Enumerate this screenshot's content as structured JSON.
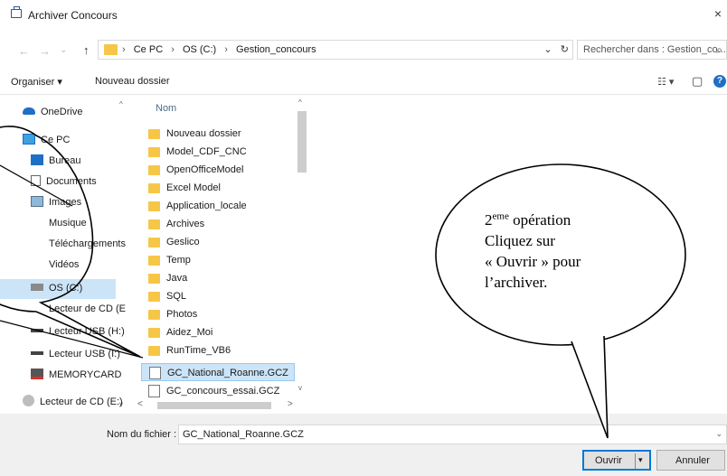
{
  "window": {
    "title": "Archiver Concours",
    "close_glyph": "×"
  },
  "nav_buttons": {
    "back": "←",
    "forward": "→",
    "recent": "⌄",
    "up": "↑"
  },
  "address": {
    "crumbs": [
      "Ce PC",
      "OS (C:)",
      "Gestion_concours"
    ],
    "separator": "›",
    "dropdown_glyph": "⌄",
    "refresh_glyph": "↻"
  },
  "search": {
    "placeholder": "Rechercher dans : Gestion_co...",
    "icon": "search-icon",
    "glyph": "⌕"
  },
  "toolbar": {
    "organise_label": "Organiser ▾",
    "new_folder_label": "Nouveau dossier",
    "view_glyph": "☷ ▾",
    "preview_glyph": "▢",
    "help_glyph": "?"
  },
  "navigation": {
    "items": [
      {
        "label": "OneDrive",
        "icon": "cloud-icon"
      },
      {
        "label": "Ce PC",
        "icon": "computer-icon"
      },
      {
        "label": "Bureau",
        "icon": "desktop-icon"
      },
      {
        "label": "Documents",
        "icon": "documents-icon"
      },
      {
        "label": "Images",
        "icon": "images-icon"
      },
      {
        "label": "Musique",
        "icon": "music-icon"
      },
      {
        "label": "Téléchargements",
        "icon": "download-icon"
      },
      {
        "label": "Vidéos",
        "icon": "videos-icon"
      },
      {
        "label": "OS (C:)",
        "icon": "drive-icon"
      },
      {
        "label": "Lecteur de CD (E",
        "icon": "cd-drive-icon"
      },
      {
        "label": "Lecteur USB (H:)",
        "icon": "usb-drive-icon"
      },
      {
        "label": "Lecteur USB (I:)",
        "icon": "usb-drive-icon"
      },
      {
        "label": "MEMORYCARD",
        "icon": "memory-card-icon"
      },
      {
        "label": "Lecteur de CD (E:)",
        "icon": "cd-drive-icon"
      }
    ],
    "selected_index": 8
  },
  "files": {
    "column_header": "Nom",
    "items": [
      {
        "name": "Nouveau dossier",
        "type": "folder"
      },
      {
        "name": "Model_CDF_CNC",
        "type": "folder"
      },
      {
        "name": "OpenOfficeModel",
        "type": "folder"
      },
      {
        "name": "Excel Model",
        "type": "folder"
      },
      {
        "name": "Application_locale",
        "type": "folder"
      },
      {
        "name": "Archives",
        "type": "folder"
      },
      {
        "name": "Geslico",
        "type": "folder"
      },
      {
        "name": "Temp",
        "type": "folder"
      },
      {
        "name": "Java",
        "type": "folder"
      },
      {
        "name": "SQL",
        "type": "folder"
      },
      {
        "name": "Photos",
        "type": "folder"
      },
      {
        "name": "Aidez_Moi",
        "type": "folder"
      },
      {
        "name": "RunTime_VB6",
        "type": "folder"
      },
      {
        "name": "GC_National_Roanne.GCZ",
        "type": "file"
      },
      {
        "name": "GC_concours_essai.GCZ",
        "type": "file"
      }
    ],
    "selected_index": 13
  },
  "scroll_glyphs": {
    "up": "^",
    "down": "v",
    "left": "<",
    "right": ">"
  },
  "footer": {
    "filename_label": "Nom du fichier :",
    "filename_value": "GC_National_Roanne.GCZ",
    "filename_dropdown": "⌄",
    "open_label": "Ouvrir",
    "open_split": "▾",
    "cancel_label": "Annuler"
  },
  "annotation": {
    "line1_prefix": "2",
    "line1_sup": "eme",
    "line1_rest": " opération",
    "line2": "Cliquez sur",
    "line3": "« Ouvrir » pour",
    "line4": "l’archiver."
  },
  "colors": {
    "accent": "#0078d7",
    "selection": "#cce4f7",
    "folder": "#f6c646"
  }
}
